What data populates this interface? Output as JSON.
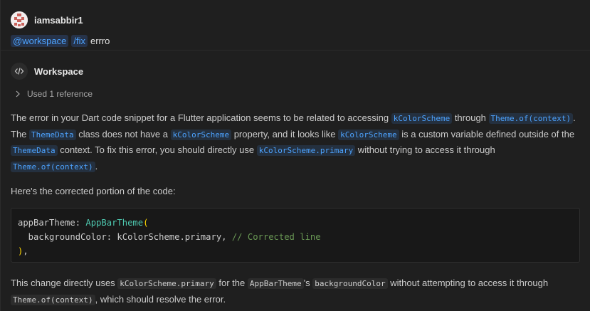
{
  "user": {
    "name": "iamsabbir1",
    "tags": [
      "@workspace",
      "/fix"
    ],
    "text": "errro"
  },
  "response": {
    "agent": "Workspace",
    "references_label": "Used 1 reference",
    "para1": {
      "t1": "The error in your Dart code snippet for a Flutter application seems to be related to accessing ",
      "c1": "kColorScheme",
      "t2": " through ",
      "c2": "Theme.of(context)",
      "t3": ".",
      "t4": "The ",
      "c3": "ThemeData",
      "t5": " class does not have a ",
      "c4": "kColorScheme",
      "t6": " property, and it looks like ",
      "c5": "kColorScheme",
      "t7": " is a custom variable defined outside of the",
      "c6": "ThemeData",
      "t8": " context. To fix this error, you should directly use ",
      "c7": "kColorScheme.primary",
      "t9": " without trying to access it through ",
      "c8": "Theme.of(context)",
      "t10": "."
    },
    "para2": "Here's the corrected portion of the code:",
    "code": {
      "l1_key": "appBarTheme: ",
      "l1_class": "AppBarTheme",
      "l1_paren": "(",
      "l2_key": "  backgroundColor: kColorScheme.primary, ",
      "l2_comment": "// Corrected line",
      "l3_paren": ")",
      "l3_rest": ","
    },
    "para3": {
      "t1": "This change directly uses ",
      "c1": "kColorScheme.primary",
      "t2": " for the ",
      "c2": "AppBarTheme",
      "t3": "'s ",
      "c3": "backgroundColor",
      "t4": " without attempting to access it through",
      "c4": "Theme.of(context)",
      "t5": ", which should resolve the error."
    }
  },
  "colors": {
    "background": "#1f1f1f",
    "link": "#4da3ff",
    "class": "#4ec9b0",
    "comment": "#6a9955"
  }
}
